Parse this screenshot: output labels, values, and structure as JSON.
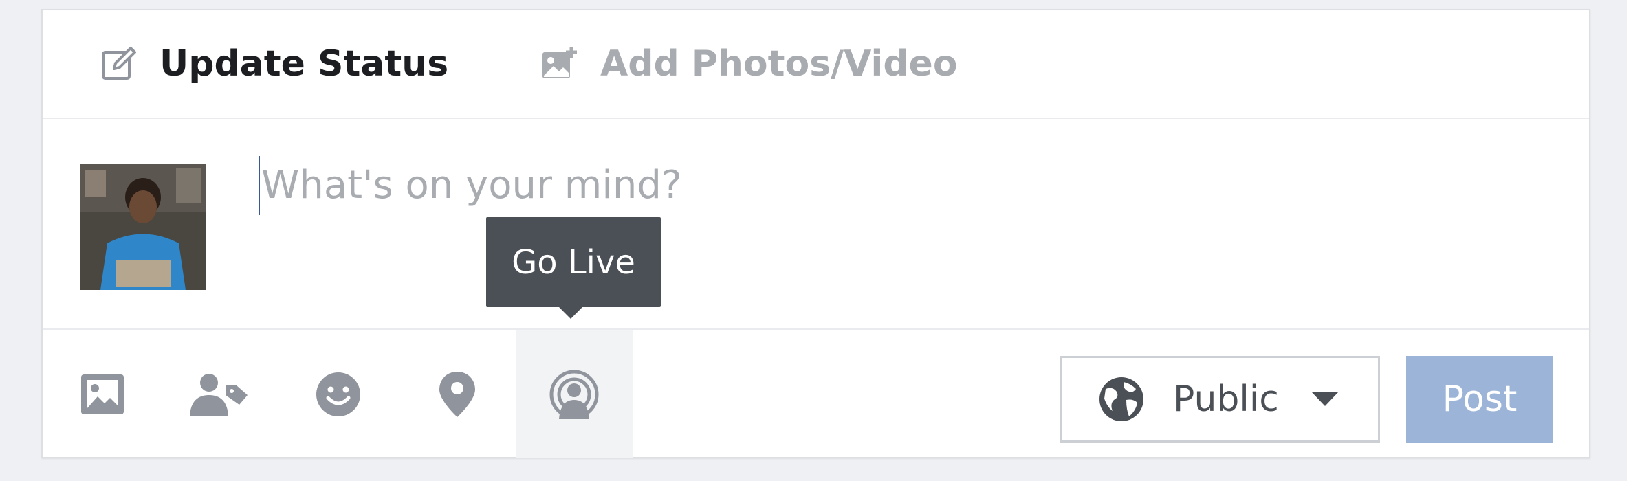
{
  "tabs": {
    "update_status": {
      "label": "Update Status",
      "icon": "edit-icon"
    },
    "add_photos": {
      "label": "Add Photos/Video",
      "icon": "add-photo-icon"
    }
  },
  "composer": {
    "placeholder": "What's on your mind?",
    "value": ""
  },
  "toolbar": {
    "tools": [
      {
        "name": "photo",
        "icon": "image-icon"
      },
      {
        "name": "tag-friends",
        "icon": "tag-person-icon"
      },
      {
        "name": "feeling",
        "icon": "smiley-icon"
      },
      {
        "name": "check-in",
        "icon": "location-pin-icon"
      },
      {
        "name": "go-live",
        "icon": "live-broadcast-icon"
      }
    ],
    "tooltip": "Go Live"
  },
  "audience": {
    "label": "Public",
    "icon": "globe-icon"
  },
  "post_button": {
    "label": "Post"
  },
  "colors": {
    "primary_text": "#1c1e21",
    "muted_text": "#a8abaf",
    "icon_gray": "#90949c",
    "post_disabled": "#9cb4d8",
    "tooltip_bg": "#4b4f56",
    "accent": "#3b5998"
  }
}
